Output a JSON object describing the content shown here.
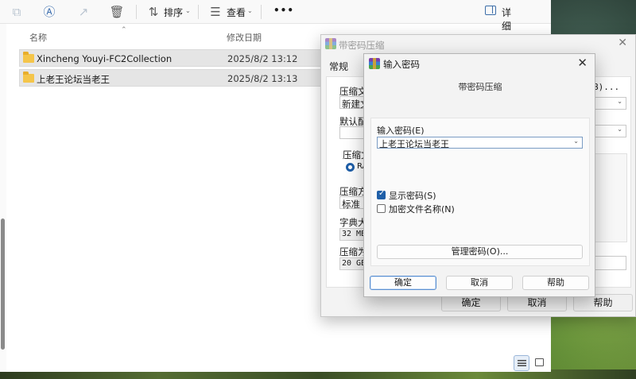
{
  "explorer": {
    "toolbar": {
      "sort_label": "排序",
      "view_label": "查看",
      "more_label": "•••",
      "details_label": "详细信息"
    },
    "columns": {
      "name": "名称",
      "date": "修改日期"
    },
    "files": [
      {
        "name": "Xincheng Youyi-FC2Collection",
        "date": "2025/8/2 13:12"
      },
      {
        "name": "上老王论坛当老王",
        "date": "2025/8/2 13:13"
      }
    ]
  },
  "archive_dialog": {
    "title": "带密码压缩",
    "tab_general": "常规",
    "fragments": {
      "archive_name_label": "压缩文",
      "archive_name_value": "新建文",
      "browse_btn": "B)...",
      "default_profile_label": "默认配",
      "format_label": "压缩文",
      "format_option": "RA",
      "method_label": "压缩方",
      "method_value": "标准",
      "dict_label": "字典大",
      "dict_value": "32 MB",
      "split_label": "压缩为",
      "split_value": "20 GB"
    },
    "ok_label": "确定",
    "cancel_label": "取消",
    "help_label": "帮助"
  },
  "password_dialog": {
    "title": "输入密码",
    "subtitle": "带密码压缩",
    "password_label": "输入密码(E)",
    "password_value": "上老王论坛当老王",
    "show_password_label": "显示密码(S)",
    "show_password_checked": true,
    "encrypt_names_label": "加密文件名称(N)",
    "encrypt_names_checked": false,
    "manage_label": "管理密码(O)...",
    "ok_label": "确定",
    "cancel_label": "取消",
    "help_label": "帮助"
  },
  "colors": {
    "accent": "#1f5fa8",
    "folder": "#f4c54a",
    "selection": "#e5e5e5"
  }
}
